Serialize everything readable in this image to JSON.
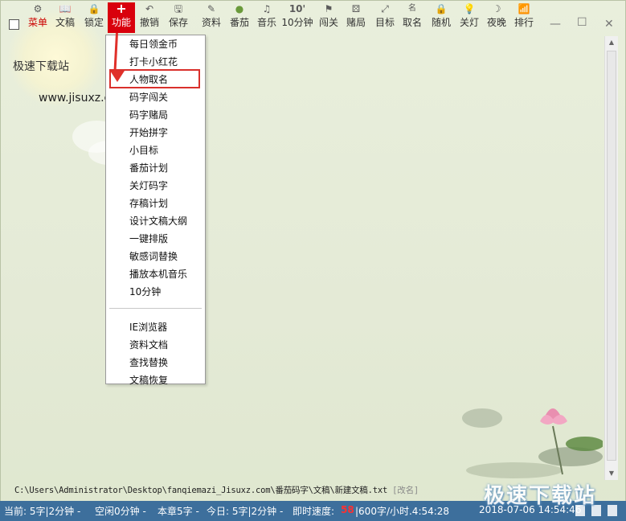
{
  "toolbar": {
    "items": [
      {
        "label": "菜单",
        "icon": "gear-icon",
        "glyph": "⚙"
      },
      {
        "label": "文稿",
        "icon": "book-icon",
        "glyph": "📖"
      },
      {
        "label": "锁定",
        "icon": "lock-icon",
        "glyph": "🔒"
      },
      {
        "label": "功能",
        "icon": "plus-icon",
        "glyph": "+"
      },
      {
        "label": "撤销",
        "icon": "undo-icon",
        "glyph": "↶"
      },
      {
        "label": "保存",
        "icon": "save-icon",
        "glyph": "🖫"
      },
      {
        "label": "资料",
        "icon": "pen-icon",
        "glyph": "✎"
      },
      {
        "label": "番茄",
        "icon": "tomato-icon",
        "glyph": "●"
      },
      {
        "label": "音乐",
        "icon": "music-icon",
        "glyph": "♫"
      },
      {
        "label": "10分钟",
        "icon": "timer-icon",
        "glyph": "10'"
      },
      {
        "label": "闯关",
        "icon": "flag-icon",
        "glyph": "⚑"
      },
      {
        "label": "赌局",
        "icon": "dice-icon",
        "glyph": "⚄"
      },
      {
        "label": "目标",
        "icon": "target-icon",
        "glyph": "⤢"
      },
      {
        "label": "取名",
        "icon": "name-icon",
        "glyph": "名"
      },
      {
        "label": "随机",
        "icon": "random-lock-icon",
        "glyph": "🔒"
      },
      {
        "label": "关灯",
        "icon": "bulb-icon",
        "glyph": "💡"
      },
      {
        "label": "夜晚",
        "icon": "moon-icon",
        "glyph": "☽"
      },
      {
        "label": "排行",
        "icon": "bar-chart-icon",
        "glyph": "📶"
      }
    ]
  },
  "window": {
    "minimize": "—",
    "maximize": "☐",
    "close": "✕"
  },
  "content": {
    "site_name": "极速下载站",
    "site_url": "www.jisuxz.c"
  },
  "menu": {
    "group1": [
      "每日领金币",
      "打卡小红花",
      "人物取名",
      "码字闯关",
      "码字赌局",
      "开始拼字",
      "小目标",
      "番茄计划",
      "关灯码字",
      "存稿计划",
      "设计文稿大纲",
      "一键排版",
      "敏感词替换",
      "播放本机音乐",
      "10分钟"
    ],
    "group2": [
      "IE浏览器",
      "资料文档",
      "查找替换",
      "文稿恢复"
    ],
    "highlighted": "人物取名"
  },
  "scrollbar": {
    "up": "▲",
    "down": "▼"
  },
  "file": {
    "path": "C:\\Users\\Administrator\\Desktop\\fanqiemazi_Jisuxz.com\\番茄码字\\文稿\\新建文稿.txt",
    "rename": "[改名]"
  },
  "status": {
    "current": "当前: 5字|2分钟 -",
    "idle": "空闲0分钟 -",
    "chapter": "本章5字 -",
    "today": "今日: 5字|2分钟 -",
    "speed_label": "即时速度:",
    "speed_value": "58",
    "rate": "|600字/小时.4:54:28",
    "datetime": "2018-07-06 14:54:46"
  },
  "watermark": "极速下载站",
  "colors": {
    "accent": "#d9000c",
    "status_bg": "#3d6f9c",
    "highlight_border": "#d9302c"
  }
}
